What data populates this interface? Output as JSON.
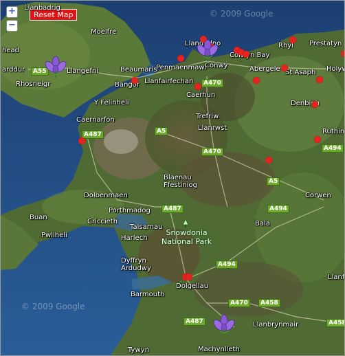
{
  "controls": {
    "zoom_in": "+",
    "zoom_out": "−",
    "reset_label": "Reset Map"
  },
  "copyright": "© 2009 Google",
  "towns": {
    "llanbadrig": "Llanbadrig",
    "moelfre": "Moelfre",
    "head": "head",
    "arddur": "arddur",
    "llangefni": "Llangefni",
    "rhosneigr": "Rhosneigr",
    "beaumaris": "Beaumaris",
    "bangor": "Bangor",
    "llanfairfechan": "Llanfairfechan",
    "penmaenmawr": "Penmaenmawr",
    "llandudno": "Llandudno",
    "conwy": "Conwy",
    "colwyn_bay": "Colwyn Bay",
    "abergele": "Abergele",
    "rhyl": "Rhyl",
    "prestatyn": "Prestatyn",
    "st_asaph": "St Asaph",
    "holywell": "Holyw",
    "caerhun": "Caerhun",
    "y_felinheli": "Y Felinheli",
    "caernarfon": "Caernarfon",
    "trefriw": "Trefriw",
    "llanrwst": "Llanrwst",
    "denbigh": "Denbigh",
    "ruthin": "Ruthin",
    "blaenau": "Blaenau\nFfestiniog",
    "dolbenmaen": "Dolbenmaen",
    "porthmadog": "Porthmadog",
    "corwen": "Corwen",
    "buan": "Buan",
    "criccieth": "Criccieth",
    "talsarnau": "Talsarnau",
    "bala": "Bala",
    "pwllheli": "Pwllheli",
    "harlech": "Harlech",
    "dyffryn": "Dyffryn\nArdudwy",
    "dolgellau": "Dolgellau",
    "barmouth": "Barmouth",
    "llanfy": "Llanfy",
    "llanbrynmair": "Llanbrynmair",
    "tywyn": "Tywyn",
    "machynlleth": "Machynlleth"
  },
  "roads": [
    "A55",
    "A470",
    "A487",
    "A5",
    "A470",
    "A494",
    "A5",
    "A494",
    "A487",
    "A494",
    "A470",
    "A458",
    "A487",
    "A458"
  ],
  "park": "Snowdonia\nNational Park",
  "marker_colors": {
    "dot": "#e5231f",
    "flower": "#8a5ad6"
  },
  "icons": {
    "marker": "red-dot-marker",
    "crocus": "crocus-flower-icon",
    "park": "park-tree-icon"
  }
}
